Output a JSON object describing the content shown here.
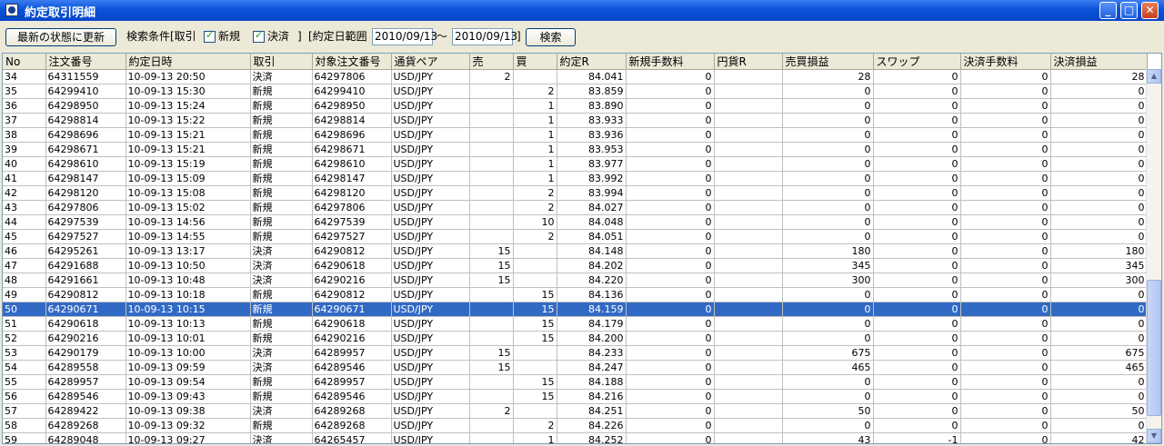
{
  "window": {
    "title": "約定取引明細"
  },
  "toolbar": {
    "refresh_label": "最新の状態に更新",
    "filter_label": "検索条件[取引",
    "new_label": "新規",
    "settle_label": "決済",
    "bracket_close": "]",
    "date_range_label": "[約定日範囲",
    "date_from": "2010/09/13",
    "tilde": "～",
    "date_to": "2010/09/13",
    "bracket_close2": "]",
    "search_label": "検索"
  },
  "columns": [
    "No",
    "注文番号",
    "約定日時",
    "取引",
    "対象注文番号",
    "通貨ペア",
    "売",
    "買",
    "約定R",
    "新規手数料",
    "円貨R",
    "売買損益",
    "スワップ",
    "決済手数料",
    "決済損益"
  ],
  "selected_row_index": 16,
  "rows": [
    [
      "34",
      "64311559",
      "10-09-13 20:50",
      "決済",
      "64297806",
      "USD/JPY",
      "2",
      "",
      "84.041",
      "0",
      "",
      "28",
      "0",
      "0",
      "28"
    ],
    [
      "35",
      "64299410",
      "10-09-13 15:30",
      "新規",
      "64299410",
      "USD/JPY",
      "",
      "2",
      "83.859",
      "0",
      "",
      "0",
      "0",
      "0",
      "0"
    ],
    [
      "36",
      "64298950",
      "10-09-13 15:24",
      "新規",
      "64298950",
      "USD/JPY",
      "",
      "1",
      "83.890",
      "0",
      "",
      "0",
      "0",
      "0",
      "0"
    ],
    [
      "37",
      "64298814",
      "10-09-13 15:22",
      "新規",
      "64298814",
      "USD/JPY",
      "",
      "1",
      "83.933",
      "0",
      "",
      "0",
      "0",
      "0",
      "0"
    ],
    [
      "38",
      "64298696",
      "10-09-13 15:21",
      "新規",
      "64298696",
      "USD/JPY",
      "",
      "1",
      "83.936",
      "0",
      "",
      "0",
      "0",
      "0",
      "0"
    ],
    [
      "39",
      "64298671",
      "10-09-13 15:21",
      "新規",
      "64298671",
      "USD/JPY",
      "",
      "1",
      "83.953",
      "0",
      "",
      "0",
      "0",
      "0",
      "0"
    ],
    [
      "40",
      "64298610",
      "10-09-13 15:19",
      "新規",
      "64298610",
      "USD/JPY",
      "",
      "1",
      "83.977",
      "0",
      "",
      "0",
      "0",
      "0",
      "0"
    ],
    [
      "41",
      "64298147",
      "10-09-13 15:09",
      "新規",
      "64298147",
      "USD/JPY",
      "",
      "1",
      "83.992",
      "0",
      "",
      "0",
      "0",
      "0",
      "0"
    ],
    [
      "42",
      "64298120",
      "10-09-13 15:08",
      "新規",
      "64298120",
      "USD/JPY",
      "",
      "2",
      "83.994",
      "0",
      "",
      "0",
      "0",
      "0",
      "0"
    ],
    [
      "43",
      "64297806",
      "10-09-13 15:02",
      "新規",
      "64297806",
      "USD/JPY",
      "",
      "2",
      "84.027",
      "0",
      "",
      "0",
      "0",
      "0",
      "0"
    ],
    [
      "44",
      "64297539",
      "10-09-13 14:56",
      "新規",
      "64297539",
      "USD/JPY",
      "",
      "10",
      "84.048",
      "0",
      "",
      "0",
      "0",
      "0",
      "0"
    ],
    [
      "45",
      "64297527",
      "10-09-13 14:55",
      "新規",
      "64297527",
      "USD/JPY",
      "",
      "2",
      "84.051",
      "0",
      "",
      "0",
      "0",
      "0",
      "0"
    ],
    [
      "46",
      "64295261",
      "10-09-13 13:17",
      "決済",
      "64290812",
      "USD/JPY",
      "15",
      "",
      "84.148",
      "0",
      "",
      "180",
      "0",
      "0",
      "180"
    ],
    [
      "47",
      "64291688",
      "10-09-13 10:50",
      "決済",
      "64290618",
      "USD/JPY",
      "15",
      "",
      "84.202",
      "0",
      "",
      "345",
      "0",
      "0",
      "345"
    ],
    [
      "48",
      "64291661",
      "10-09-13 10:48",
      "決済",
      "64290216",
      "USD/JPY",
      "15",
      "",
      "84.220",
      "0",
      "",
      "300",
      "0",
      "0",
      "300"
    ],
    [
      "49",
      "64290812",
      "10-09-13 10:18",
      "新規",
      "64290812",
      "USD/JPY",
      "",
      "15",
      "84.136",
      "0",
      "",
      "0",
      "0",
      "0",
      "0"
    ],
    [
      "50",
      "64290671",
      "10-09-13 10:15",
      "新規",
      "64290671",
      "USD/JPY",
      "",
      "15",
      "84.159",
      "0",
      "",
      "0",
      "0",
      "0",
      "0"
    ],
    [
      "51",
      "64290618",
      "10-09-13 10:13",
      "新規",
      "64290618",
      "USD/JPY",
      "",
      "15",
      "84.179",
      "0",
      "",
      "0",
      "0",
      "0",
      "0"
    ],
    [
      "52",
      "64290216",
      "10-09-13 10:01",
      "新規",
      "64290216",
      "USD/JPY",
      "",
      "15",
      "84.200",
      "0",
      "",
      "0",
      "0",
      "0",
      "0"
    ],
    [
      "53",
      "64290179",
      "10-09-13 10:00",
      "決済",
      "64289957",
      "USD/JPY",
      "15",
      "",
      "84.233",
      "0",
      "",
      "675",
      "0",
      "0",
      "675"
    ],
    [
      "54",
      "64289558",
      "10-09-13 09:59",
      "決済",
      "64289546",
      "USD/JPY",
      "15",
      "",
      "84.247",
      "0",
      "",
      "465",
      "0",
      "0",
      "465"
    ],
    [
      "55",
      "64289957",
      "10-09-13 09:54",
      "新規",
      "64289957",
      "USD/JPY",
      "",
      "15",
      "84.188",
      "0",
      "",
      "0",
      "0",
      "0",
      "0"
    ],
    [
      "56",
      "64289546",
      "10-09-13 09:43",
      "新規",
      "64289546",
      "USD/JPY",
      "",
      "15",
      "84.216",
      "0",
      "",
      "0",
      "0",
      "0",
      "0"
    ],
    [
      "57",
      "64289422",
      "10-09-13 09:38",
      "決済",
      "64289268",
      "USD/JPY",
      "2",
      "",
      "84.251",
      "0",
      "",
      "50",
      "0",
      "0",
      "50"
    ],
    [
      "58",
      "64289268",
      "10-09-13 09:32",
      "新規",
      "64289268",
      "USD/JPY",
      "",
      "2",
      "84.226",
      "0",
      "",
      "0",
      "0",
      "0",
      "0"
    ],
    [
      "59",
      "64289048",
      "10-09-13 09:27",
      "決済",
      "64265457",
      "USD/JPY",
      "",
      "1",
      "84.252",
      "0",
      "",
      "43",
      "-1",
      "0",
      "42"
    ]
  ]
}
